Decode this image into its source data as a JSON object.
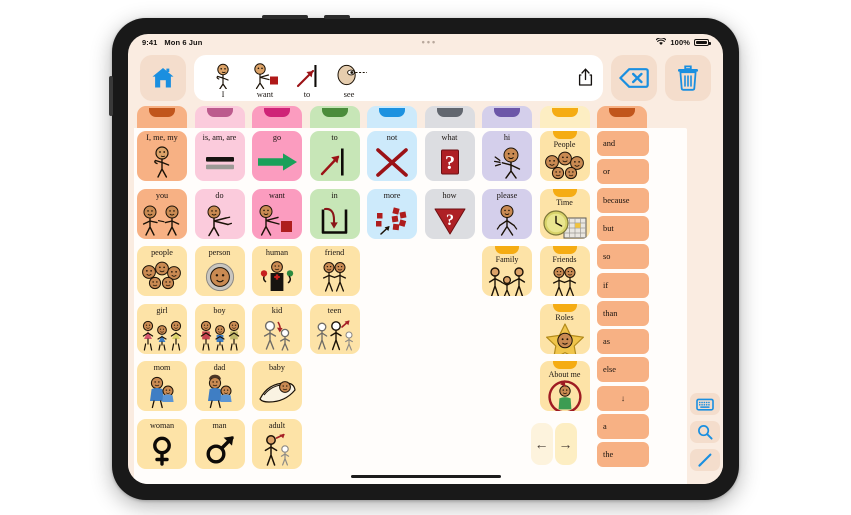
{
  "device": {
    "type": "tablet"
  },
  "statusbar": {
    "time": "9:41",
    "date": "Mon 6 Jun",
    "battery_pct": "100%",
    "wifi_icon": "wifi-icon",
    "battery_icon": "battery-icon"
  },
  "toolbar": {
    "home_label": "home-icon",
    "share_label": "share-icon",
    "backspace_label": "backspace-icon",
    "clear_label": "trash-icon",
    "sentence": [
      {
        "label": "I",
        "icon": "person-pointing-self"
      },
      {
        "label": "want",
        "icon": "person-reaching-red-square"
      },
      {
        "label": "to",
        "icon": "red-arrow-to-line"
      },
      {
        "label": "see",
        "icon": "face-eye-looking"
      }
    ]
  },
  "colors": {
    "screen_bg": "#faece1",
    "grid_bg": "#fffdfb",
    "accent_blue": "#1a8fe0",
    "orange_word": "#f7b184",
    "folder_yellow": "#fde3a7",
    "folder_tab": "#f5ac13"
  },
  "grid": {
    "tabs": [
      {
        "name": "pronouns-tab",
        "fill": "#f7b184",
        "tab": "#c1561c"
      },
      {
        "name": "verbs-be-tab",
        "fill": "#fbcbdc",
        "tab": "#bc5b8d"
      },
      {
        "name": "verbs-tab",
        "fill": "#fb9cbf",
        "tab": "#cf2377"
      },
      {
        "name": "prepositions-tab",
        "fill": "#c7e6b7",
        "tab": "#4b8c3b"
      },
      {
        "name": "negation-tab",
        "fill": "#cdeafb",
        "tab": "#1d92e0"
      },
      {
        "name": "questions-tab",
        "fill": "#dcdde1",
        "tab": "#62676f"
      },
      {
        "name": "social-tab",
        "fill": "#d4cfeb",
        "tab": "#6c57a8"
      },
      {
        "name": "people-tab",
        "fill": "#fdeec3",
        "tab": "#f5ac13"
      },
      {
        "name": "conjunctions-tab",
        "fill": "#f7b184",
        "tab": "#c1561c"
      }
    ],
    "rows": [
      [
        {
          "label": "I, me, my",
          "fill": "#f7b184",
          "icon": "person-pointing-self"
        },
        {
          "label": "is, am, are",
          "fill": "#fbcbdc",
          "icon": "equals-sign"
        },
        {
          "label": "go",
          "fill": "#fb9cbf",
          "icon": "green-arrow-right"
        },
        {
          "label": "to",
          "fill": "#c7e6b7",
          "icon": "arrow-to-line"
        },
        {
          "label": "not",
          "fill": "#cdeafb",
          "icon": "red-x"
        },
        {
          "label": "what",
          "fill": "#dcdde1",
          "icon": "red-question-square"
        },
        {
          "label": "hi",
          "fill": "#d4cfeb",
          "icon": "person-waving"
        }
      ],
      [
        {
          "label": "you",
          "fill": "#f7b184",
          "icon": "two-people-pointing"
        },
        {
          "label": "do",
          "fill": "#fbcbdc",
          "icon": "person-action"
        },
        {
          "label": "want",
          "fill": "#fb9cbf",
          "icon": "person-reaching-red-square"
        },
        {
          "label": "in",
          "fill": "#c7e6b7",
          "icon": "arrow-into-box"
        },
        {
          "label": "more",
          "fill": "#cdeafb",
          "icon": "red-blocks-more"
        },
        {
          "label": "how",
          "fill": "#dcdde1",
          "icon": "red-question-triangle"
        },
        {
          "label": "please",
          "fill": "#d4cfeb",
          "icon": "person-asking"
        }
      ],
      [
        {
          "label": "people",
          "fill": "#fde3a7",
          "icon": "group-of-faces"
        },
        {
          "label": "person",
          "fill": "#fde3a7",
          "icon": "single-face"
        },
        {
          "label": "human",
          "fill": "#fde3a7",
          "icon": "human-figure-anatomy"
        },
        {
          "label": "friend",
          "fill": "#fde3a7",
          "icon": "two-figures"
        }
      ],
      [
        {
          "label": "girl",
          "fill": "#fde3a7",
          "icon": "girl-figures"
        },
        {
          "label": "boy",
          "fill": "#fde3a7",
          "icon": "boy-figures"
        },
        {
          "label": "kid",
          "fill": "#fde3a7",
          "icon": "child-figure-arrow"
        },
        {
          "label": "teen",
          "fill": "#fde3a7",
          "icon": "teen-figures-arrow"
        }
      ],
      [
        {
          "label": "mom",
          "fill": "#fde3a7",
          "icon": "mother-holding-baby"
        },
        {
          "label": "dad",
          "fill": "#fde3a7",
          "icon": "father-holding-baby"
        },
        {
          "label": "baby",
          "fill": "#fde3a7",
          "icon": "baby-in-blanket"
        }
      ],
      [
        {
          "label": "woman",
          "fill": "#fde3a7",
          "icon": "venus-symbol"
        },
        {
          "label": "man",
          "fill": "#fde3a7",
          "icon": "mars-symbol"
        },
        {
          "label": "adult",
          "fill": "#fde3a7",
          "icon": "adult-child-figures"
        }
      ]
    ],
    "folders": [
      {
        "label": "People",
        "icon": "group-of-faces",
        "row": 0
      },
      {
        "label": "Time",
        "icon": "clock-calendar",
        "row": 1
      },
      {
        "label": "Friends",
        "icon": "two-figures",
        "row": 2
      },
      {
        "label": "Roles",
        "icon": "star-face",
        "row": 3
      },
      {
        "label": "About me",
        "icon": "person-circle-arrow",
        "row": 4
      }
    ],
    "family_folder": {
      "label": "Family",
      "icon": "family-figures"
    },
    "nav": {
      "prev": "←",
      "next": "→",
      "prev_name": "previous-page-button",
      "next_name": "next-page-button"
    },
    "words": [
      "and",
      "or",
      "because",
      "but",
      "so",
      "if",
      "than",
      "as",
      "else",
      "↓",
      "a",
      "the"
    ]
  },
  "rail": {
    "buttons": [
      {
        "name": "keyboard-button",
        "icon": "keyboard-icon"
      },
      {
        "name": "search-button",
        "icon": "search-icon"
      },
      {
        "name": "edit-button",
        "icon": "pencil-icon"
      }
    ]
  }
}
